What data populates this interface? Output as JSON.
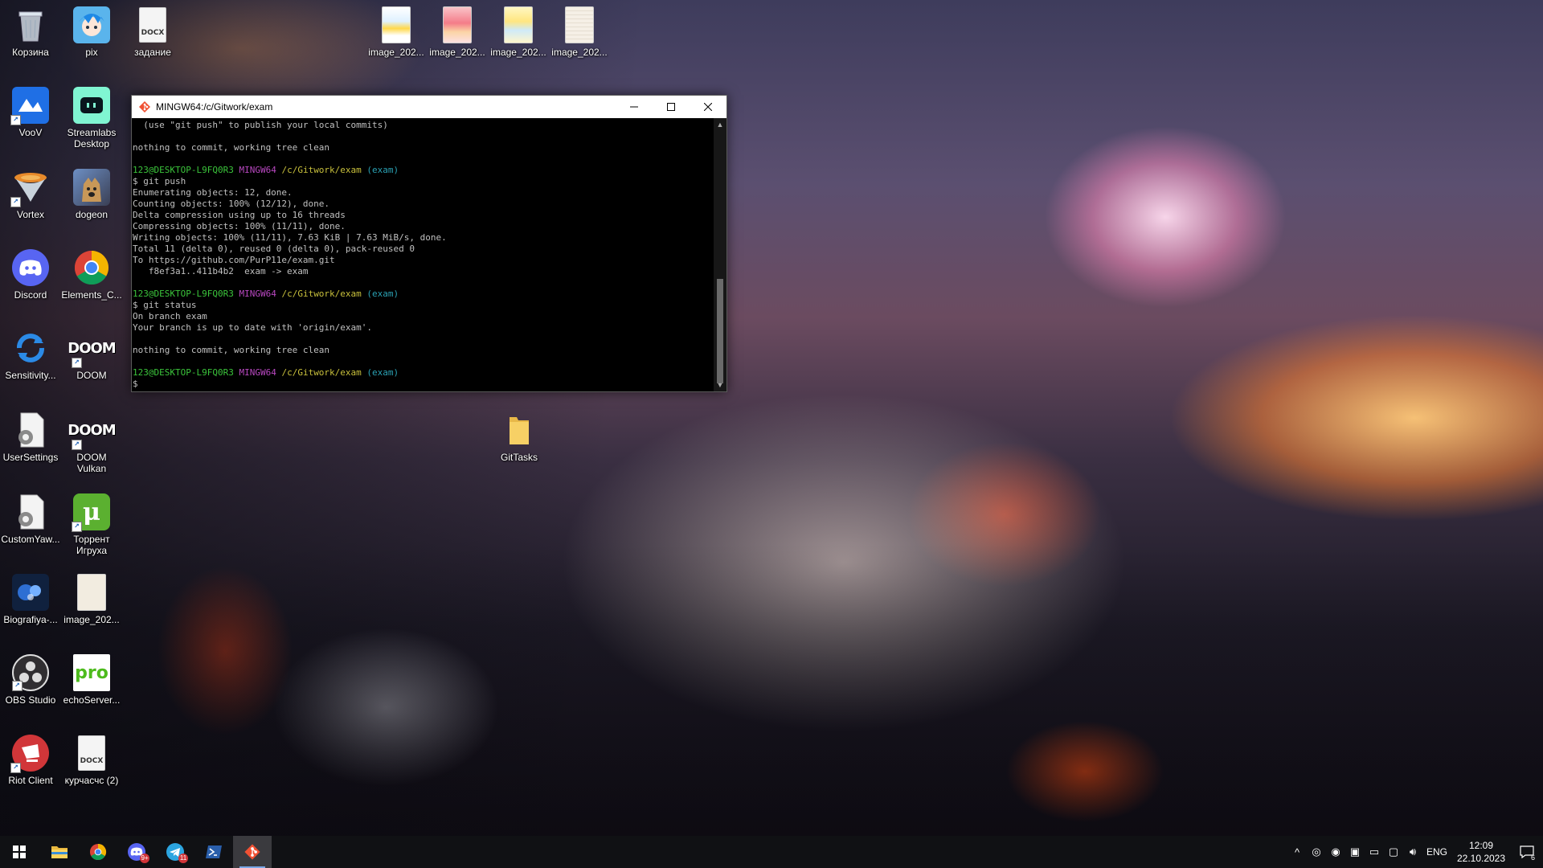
{
  "desktop_icons": [
    {
      "label": "Корзина",
      "icon": "recycle-bin-icon"
    },
    {
      "label": "pix",
      "icon": "image-icon"
    },
    {
      "label": "задание",
      "icon": "docx-file-icon"
    },
    {
      "label": "image_202...",
      "icon": "image-file-icon"
    },
    {
      "label": "image_202...",
      "icon": "image-file-icon"
    },
    {
      "label": "image_202...",
      "icon": "image-file-icon"
    },
    {
      "label": "image_202...",
      "icon": "image-file-icon"
    },
    {
      "label": "VooV",
      "icon": "voov-icon"
    },
    {
      "label": "Streamlabs Desktop",
      "icon": "streamlabs-icon"
    },
    {
      "label": "Vortex",
      "icon": "vortex-icon"
    },
    {
      "label": "dogeon",
      "icon": "image-icon"
    },
    {
      "label": "Discord",
      "icon": "discord-icon"
    },
    {
      "label": "Elements_C...",
      "icon": "chrome-icon"
    },
    {
      "label": "Sensitivity...",
      "icon": "sync-icon"
    },
    {
      "label": "DOOM",
      "icon": "doom-icon"
    },
    {
      "label": "UserSettings",
      "icon": "settings-file-icon"
    },
    {
      "label": "DOOM Vulkan",
      "icon": "doom-icon"
    },
    {
      "label": "CustomYaw...",
      "icon": "settings-file-icon"
    },
    {
      "label": "Торрент Игруха",
      "icon": "utorrent-icon"
    },
    {
      "label": "Biografiya-...",
      "icon": "video-icon"
    },
    {
      "label": "image_202...",
      "icon": "image-file-icon"
    },
    {
      "label": "OBS Studio",
      "icon": "obs-icon"
    },
    {
      "label": "echoServer...",
      "icon": "pro-icon"
    },
    {
      "label": "Riot Client",
      "icon": "riot-icon"
    },
    {
      "label": "курчасчс (2)",
      "icon": "docx-file-icon"
    },
    {
      "label": "GitTasks",
      "icon": "folder-icon"
    }
  ],
  "terminal": {
    "title": "MINGW64:/c/Gitwork/exam",
    "lines": [
      {
        "segments": [
          {
            "text": "  (use \"git push\" to publish your local commits)",
            "cls": ""
          }
        ]
      },
      {
        "segments": [
          {
            "text": "",
            "cls": ""
          }
        ]
      },
      {
        "segments": [
          {
            "text": "nothing to commit, working tree clean",
            "cls": ""
          }
        ]
      },
      {
        "segments": [
          {
            "text": "",
            "cls": ""
          }
        ]
      },
      {
        "segments": [
          {
            "text": "123@DESKTOP-L9FQ0R3",
            "cls": "c-green"
          },
          {
            "text": " ",
            "cls": ""
          },
          {
            "text": "MINGW64",
            "cls": "c-purple"
          },
          {
            "text": " ",
            "cls": ""
          },
          {
            "text": "/c/Gitwork/exam",
            "cls": "c-yellow"
          },
          {
            "text": " ",
            "cls": ""
          },
          {
            "text": "(exam)",
            "cls": "c-cyan"
          }
        ]
      },
      {
        "segments": [
          {
            "text": "$ git push",
            "cls": ""
          }
        ]
      },
      {
        "segments": [
          {
            "text": "Enumerating objects: 12, done.",
            "cls": ""
          }
        ]
      },
      {
        "segments": [
          {
            "text": "Counting objects: 100% (12/12), done.",
            "cls": ""
          }
        ]
      },
      {
        "segments": [
          {
            "text": "Delta compression using up to 16 threads",
            "cls": ""
          }
        ]
      },
      {
        "segments": [
          {
            "text": "Compressing objects: 100% (11/11), done.",
            "cls": ""
          }
        ]
      },
      {
        "segments": [
          {
            "text": "Writing objects: 100% (11/11), 7.63 KiB | 7.63 MiB/s, done.",
            "cls": ""
          }
        ]
      },
      {
        "segments": [
          {
            "text": "Total 11 (delta 0), reused 0 (delta 0), pack-reused 0",
            "cls": ""
          }
        ]
      },
      {
        "segments": [
          {
            "text": "To https://github.com/PurP11e/exam.git",
            "cls": ""
          }
        ]
      },
      {
        "segments": [
          {
            "text": "   f8ef3a1..411b4b2  exam -> exam",
            "cls": ""
          }
        ]
      },
      {
        "segments": [
          {
            "text": "",
            "cls": ""
          }
        ]
      },
      {
        "segments": [
          {
            "text": "123@DESKTOP-L9FQ0R3",
            "cls": "c-green"
          },
          {
            "text": " ",
            "cls": ""
          },
          {
            "text": "MINGW64",
            "cls": "c-purple"
          },
          {
            "text": " ",
            "cls": ""
          },
          {
            "text": "/c/Gitwork/exam",
            "cls": "c-yellow"
          },
          {
            "text": " ",
            "cls": ""
          },
          {
            "text": "(exam)",
            "cls": "c-cyan"
          }
        ]
      },
      {
        "segments": [
          {
            "text": "$ git status",
            "cls": ""
          }
        ]
      },
      {
        "segments": [
          {
            "text": "On branch exam",
            "cls": ""
          }
        ]
      },
      {
        "segments": [
          {
            "text": "Your branch is up to date with 'origin/exam'.",
            "cls": ""
          }
        ]
      },
      {
        "segments": [
          {
            "text": "",
            "cls": ""
          }
        ]
      },
      {
        "segments": [
          {
            "text": "nothing to commit, working tree clean",
            "cls": ""
          }
        ]
      },
      {
        "segments": [
          {
            "text": "",
            "cls": ""
          }
        ]
      },
      {
        "segments": [
          {
            "text": "123@DESKTOP-L9FQ0R3",
            "cls": "c-green"
          },
          {
            "text": " ",
            "cls": ""
          },
          {
            "text": "MINGW64",
            "cls": "c-purple"
          },
          {
            "text": " ",
            "cls": ""
          },
          {
            "text": "/c/Gitwork/exam",
            "cls": "c-yellow"
          },
          {
            "text": " ",
            "cls": ""
          },
          {
            "text": "(exam)",
            "cls": "c-cyan"
          }
        ]
      },
      {
        "segments": [
          {
            "text": "$",
            "cls": ""
          }
        ]
      }
    ]
  },
  "taskbar": {
    "apps": [
      {
        "name": "start-button",
        "icon": "windows-logo-icon"
      },
      {
        "name": "taskbar-explorer",
        "icon": "folder-icon"
      },
      {
        "name": "taskbar-chrome",
        "icon": "chrome-icon"
      },
      {
        "name": "taskbar-discord",
        "icon": "discord-icon"
      },
      {
        "name": "taskbar-telegram",
        "icon": "telegram-icon"
      },
      {
        "name": "taskbar-powershell",
        "icon": "powershell-icon"
      },
      {
        "name": "taskbar-git-bash",
        "icon": "git-icon"
      }
    ],
    "discord_badge": "9+",
    "telegram_badge": "11",
    "tray": {
      "language": "ENG",
      "time": "12:09",
      "date": "22.10.2023",
      "notifications": "6"
    }
  },
  "colors": {
    "taskbar_bg": "#101114",
    "terminal_bg": "#000000",
    "prompt_user": "#3bc43b",
    "prompt_env": "#b848c0",
    "prompt_path": "#c8c03c",
    "prompt_branch": "#2aa1b3"
  }
}
